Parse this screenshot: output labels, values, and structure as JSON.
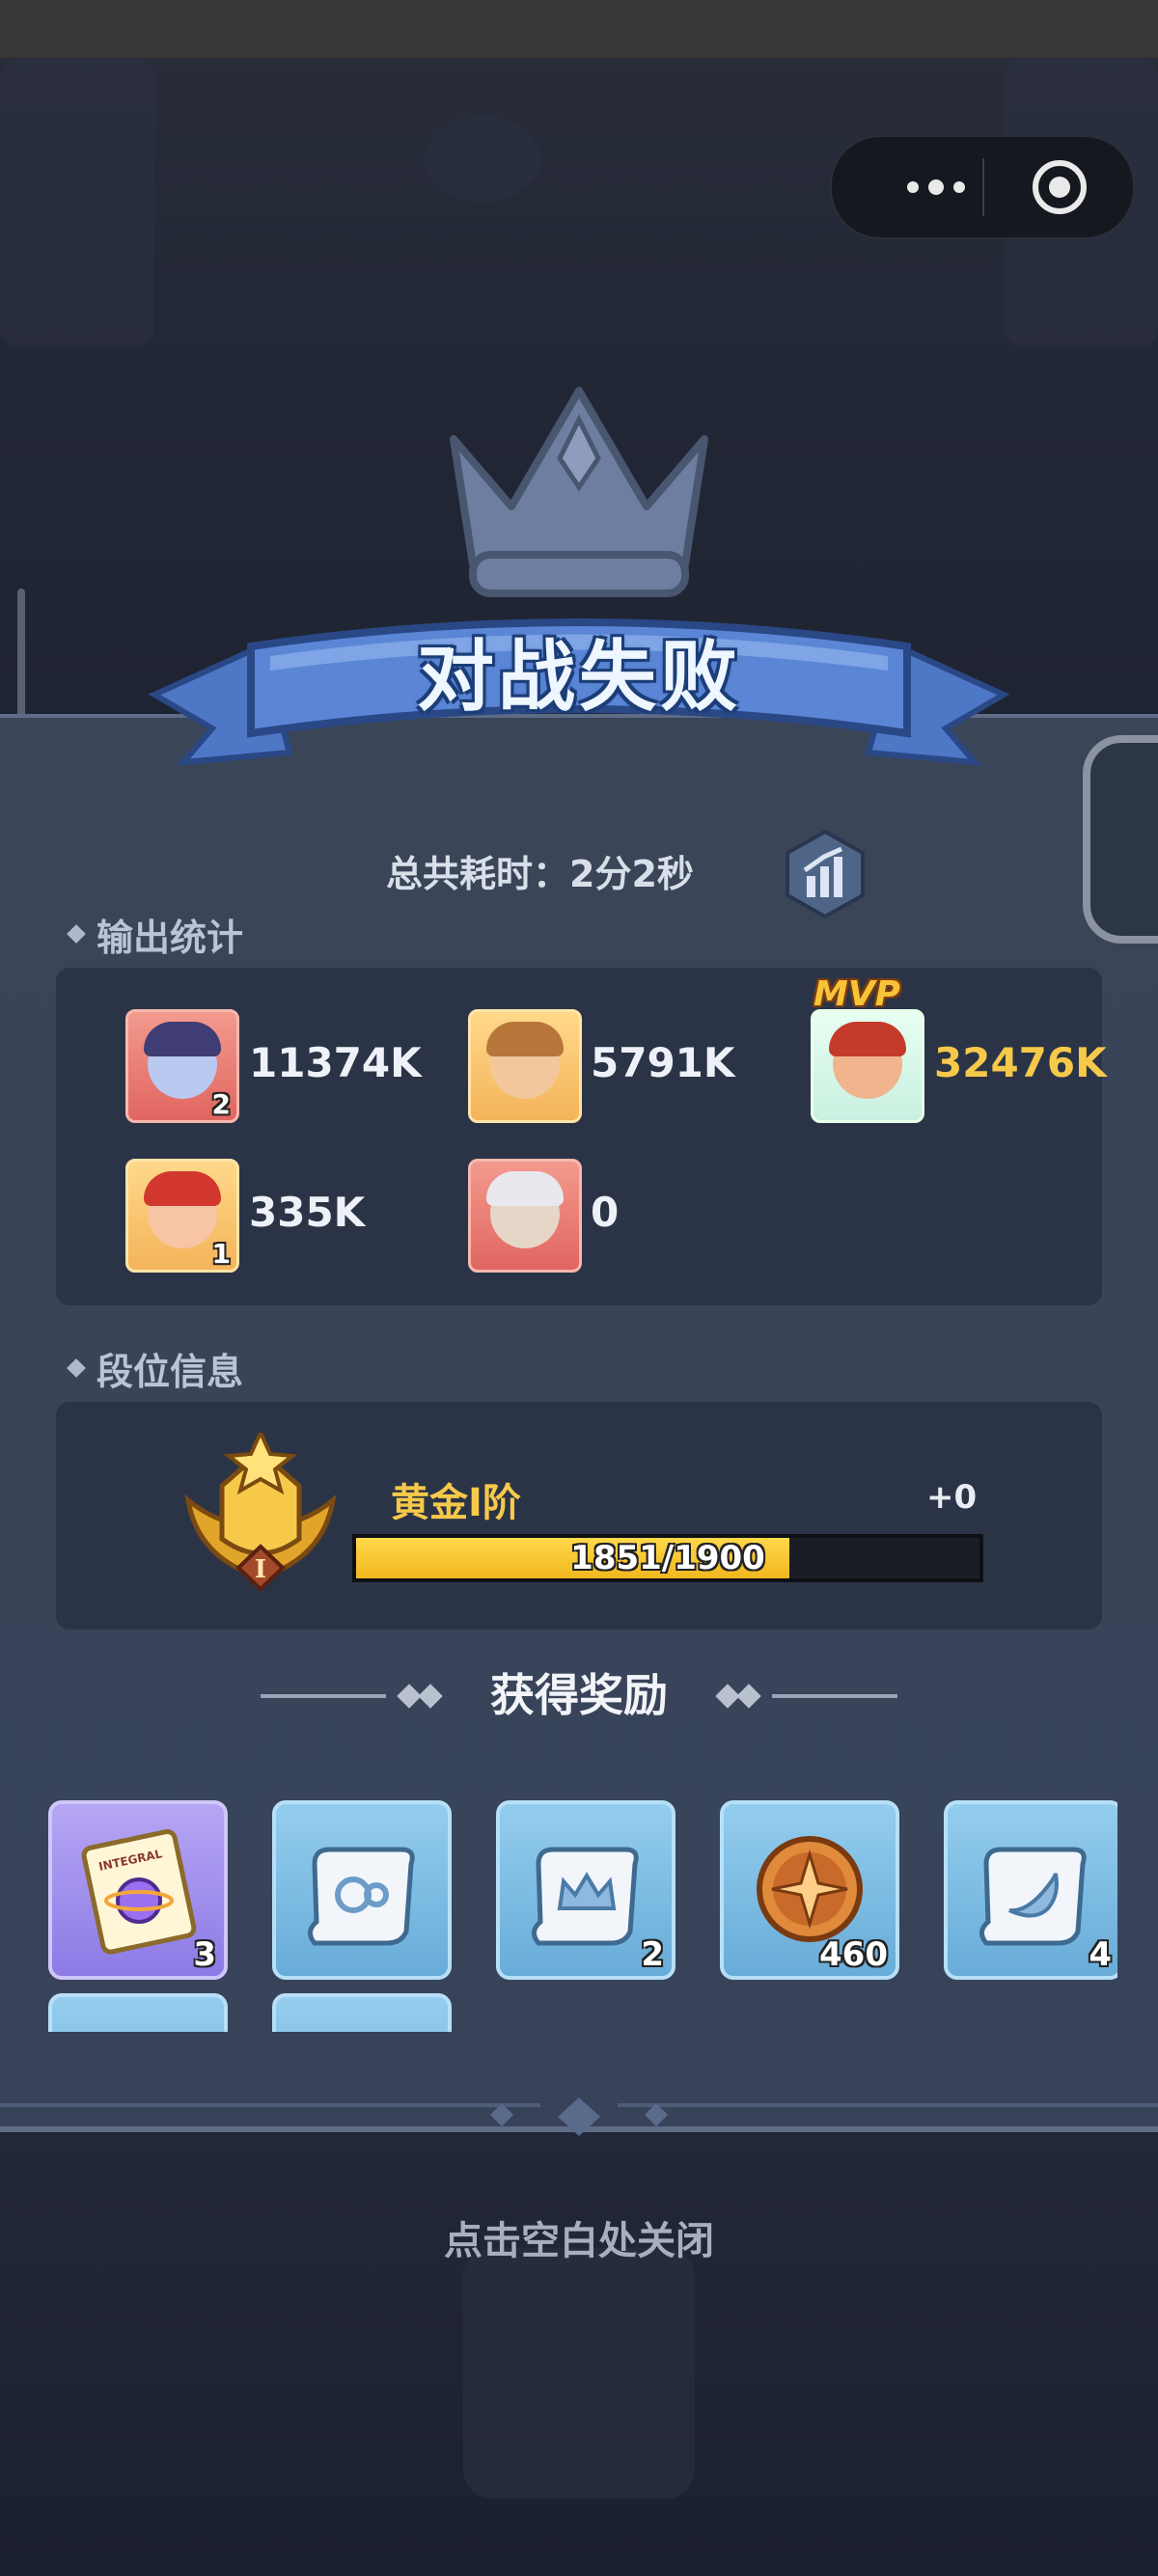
{
  "result": {
    "title": "对战失败"
  },
  "time": {
    "label": "总共耗时：",
    "value": "2分2秒"
  },
  "output_stats": {
    "heading": "输出统计",
    "mvp_label": "MVP",
    "heroes": [
      {
        "damage": "11374K",
        "level": "2",
        "frame": "red"
      },
      {
        "damage": "5791K",
        "level": "",
        "frame": "gold"
      },
      {
        "damage": "32476K",
        "level": "",
        "frame": "mvp",
        "mvp": true
      },
      {
        "damage": "335K",
        "level": "1",
        "frame": "gold"
      },
      {
        "damage": "0",
        "level": "",
        "frame": "red"
      }
    ]
  },
  "rank": {
    "heading": "段位信息",
    "name": "黄金I阶",
    "delta": "+0",
    "progress_text": "1851/1900",
    "progress_current": 1851,
    "progress_max": 1900,
    "emblem_numeral": "I"
  },
  "rewards": {
    "heading": "获得奖励",
    "items": [
      {
        "icon": "integral-ticket-icon",
        "qty": "3",
        "frame": "purple",
        "label": "INTEGRAL"
      },
      {
        "icon": "scroll-icon",
        "qty": "",
        "frame": "blue"
      },
      {
        "icon": "scroll-crown-icon",
        "qty": "2",
        "frame": "blue"
      },
      {
        "icon": "compass-coin-icon",
        "qty": "460",
        "frame": "blue"
      },
      {
        "icon": "scroll-horn-icon",
        "qty": "4",
        "frame": "blue"
      }
    ]
  },
  "footer": {
    "close_hint": "点击空白处关闭"
  },
  "colors": {
    "panel": "#38435a",
    "gold": "#f6c94a",
    "banner": "#5b86d6"
  }
}
